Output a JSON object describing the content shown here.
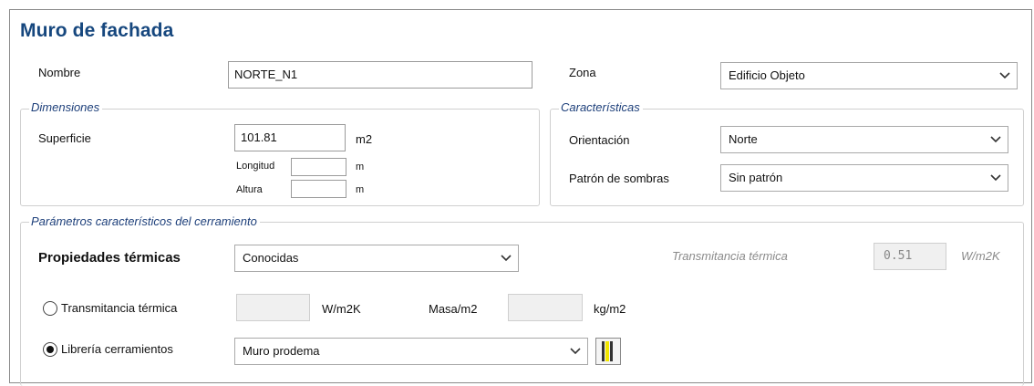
{
  "title": "Muro de fachada",
  "nombre": {
    "label": "Nombre",
    "value": "NORTE_N1"
  },
  "zona": {
    "label": "Zona",
    "value": "Edificio Objeto"
  },
  "dimensiones": {
    "legend": "Dimensiones",
    "superficie_label": "Superficie",
    "superficie_value": "101.81",
    "superficie_unit": "m2",
    "longitud_label": "Longitud",
    "longitud_value": "",
    "longitud_unit": "m",
    "altura_label": "Altura",
    "altura_value": "",
    "altura_unit": "m"
  },
  "caracteristicas": {
    "legend": "Características",
    "orientacion_label": "Orientación",
    "orientacion_value": "Norte",
    "sombras_label": "Patrón de sombras",
    "sombras_value": "Sin patrón"
  },
  "parametros": {
    "legend": "Parámetros característicos del cerramiento",
    "propiedades_label": "Propiedades térmicas",
    "propiedades_value": "Conocidas",
    "transmitancia_ro_label": "Transmitancia térmica",
    "transmitancia_ro_value": "0.51",
    "transmitancia_ro_unit": "W/m2K",
    "radio_transmitancia_label": "Transmitancia térmica",
    "radio_transmitancia_value": "",
    "radio_transmitancia_unit": "W/m2K",
    "radio_transmitancia_selected": false,
    "masa_label": "Masa/m2",
    "masa_value": "",
    "masa_unit": "kg/m2",
    "radio_libreria_label": "Librería cerramientos",
    "radio_libreria_selected": true,
    "libreria_value": "Muro prodema"
  },
  "icons": {
    "dropdown": "chevron-down-icon",
    "library": "wall-layers-icon"
  },
  "colors": {
    "title": "#16477e",
    "legend": "#1d3f7a",
    "library_icon_accent": "#f2e600"
  }
}
